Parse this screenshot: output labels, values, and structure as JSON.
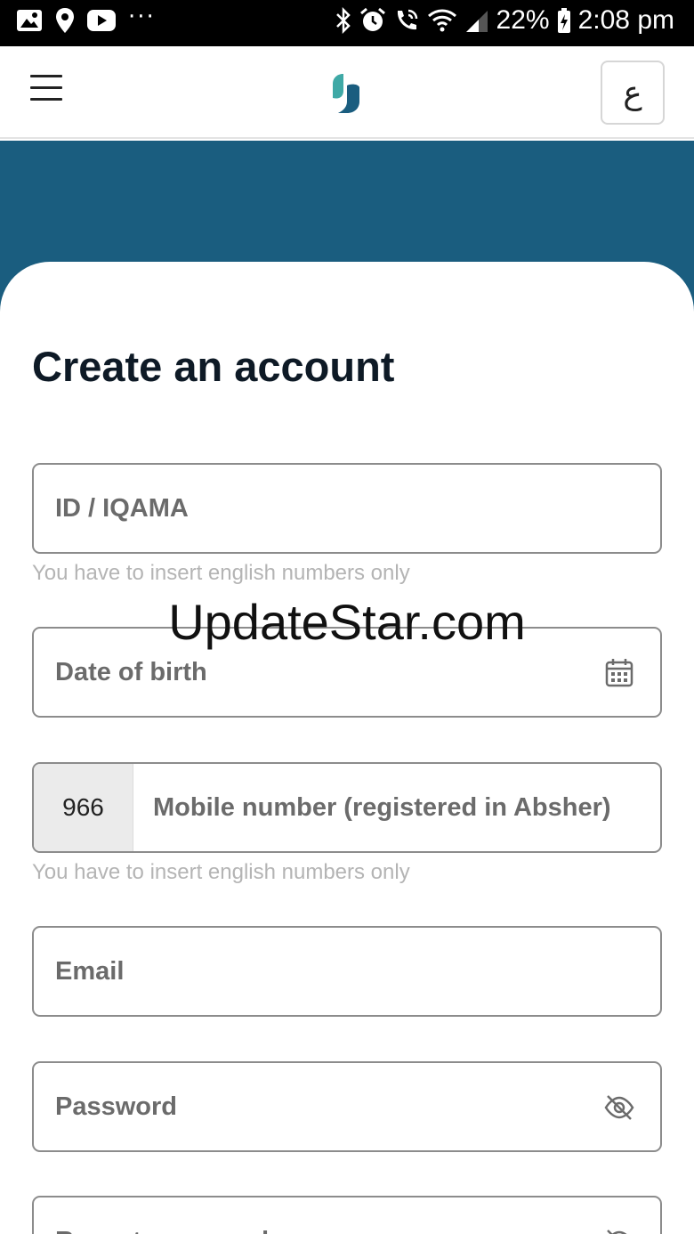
{
  "status_bar": {
    "battery": "22%",
    "time": "2:08 pm",
    "left_icons": [
      "gallery-icon",
      "location-icon",
      "youtube-icon",
      "more-icon"
    ],
    "right_icons": [
      "bluetooth-icon",
      "alarm-icon",
      "wifi-call-icon",
      "wifi-icon",
      "signal-icon",
      "battery-icon"
    ]
  },
  "header": {
    "menu_icon": "hamburger-menu-icon",
    "language_button_label": "ع"
  },
  "form": {
    "title": "Create an account",
    "id_iqama": {
      "placeholder": "ID / IQAMA",
      "hint": "You have to insert english numbers only"
    },
    "date_of_birth": {
      "placeholder": "Date of birth",
      "icon": "calendar-icon"
    },
    "mobile": {
      "prefix": "966",
      "placeholder": "Mobile number (registered in Absher)",
      "hint": "You have to insert english numbers only"
    },
    "email": {
      "placeholder": "Email"
    },
    "password": {
      "placeholder": "Password",
      "icon": "eye-off-icon"
    },
    "repeat_password": {
      "placeholder": "Repeat password",
      "icon": "eye-off-icon"
    }
  },
  "watermark": "UpdateStar.com",
  "colors": {
    "brand_teal": "#1a5d7f",
    "logo_light": "#3fa9a6",
    "logo_dark": "#1a5d7f"
  }
}
